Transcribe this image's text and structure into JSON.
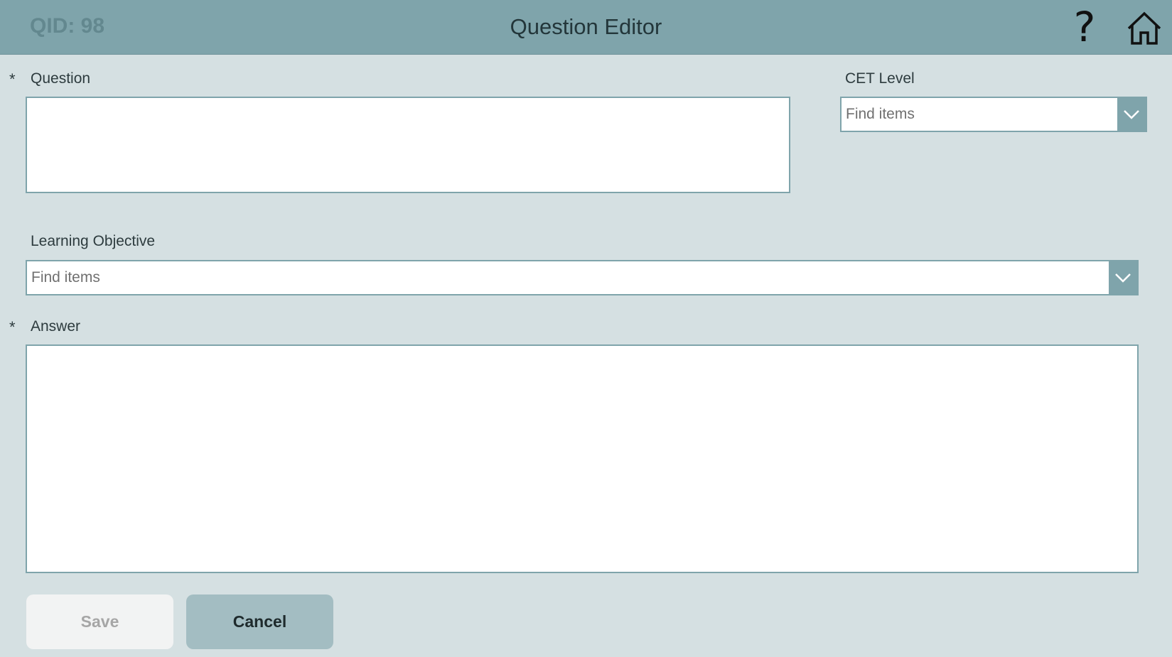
{
  "header": {
    "qid": "QID: 98",
    "title": "Question Editor",
    "help_glyph": "?",
    "help_icon": "question-mark-icon",
    "home_icon": "home-icon",
    "bar_color": "#7fa4ab"
  },
  "form": {
    "required_marker": "*",
    "question": {
      "label": "Question",
      "value": ""
    },
    "cet_level": {
      "label": "CET Level",
      "placeholder": "Find items",
      "value": ""
    },
    "learning_objective": {
      "label": "Learning Objective",
      "placeholder": "Find items",
      "value": ""
    },
    "answer": {
      "label": "Answer",
      "value": ""
    }
  },
  "actions": {
    "save_label": "Save",
    "cancel_label": "Cancel"
  },
  "colors": {
    "background": "#d5e0e2",
    "accent": "#7fa4ab",
    "cancel_button": "#a3bdc2",
    "save_button_disabled": "#f2f3f3"
  }
}
